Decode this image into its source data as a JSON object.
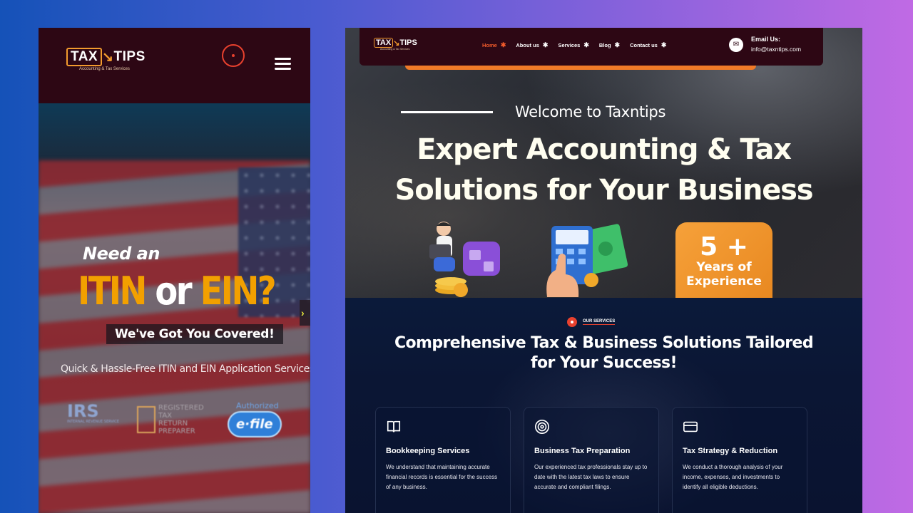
{
  "mobile": {
    "logo": {
      "tax": "TAX",
      "tips": "TIPS",
      "tagline": "Accounting & Tax Services"
    },
    "hero": {
      "need_an": "Need an",
      "itin": "ITIN",
      "or": "or",
      "ein": "EIN?",
      "covered": "We've Got You Covered!",
      "quick": "Quick & Hassle-Free ITIN and EIN Application Services",
      "irs": "IRS",
      "irs_sub": "INTERNAL REVENUE SERVICE",
      "registered": "REGISTERED TAX RETURN PREPARER",
      "authorized": "Authorized",
      "efile": "e·file"
    }
  },
  "desktop": {
    "logo": {
      "tax": "TAX",
      "tips": "TIPS",
      "tagline": "Accounting & Tax Services"
    },
    "nav": [
      {
        "label": "Home",
        "active": true
      },
      {
        "label": "About us",
        "active": false
      },
      {
        "label": "Services",
        "active": false
      },
      {
        "label": "Blog",
        "active": false
      },
      {
        "label": "Contact us",
        "active": false
      }
    ],
    "email_label": "Email Us:",
    "email_value": "info@taxntips.com",
    "hero": {
      "welcome": "Welcome to Taxntips",
      "headline_1": "Expert Accounting & Tax",
      "headline_2": "Solutions for Your Business",
      "exp_num": "5 +",
      "exp_1": "Years of",
      "exp_2": "Experience"
    },
    "services": {
      "tag": "OUR SERVICES",
      "title_1": "Comprehensive Tax & Business Solutions Tailored",
      "title_2": "for Your Success!",
      "cards": [
        {
          "icon": "book-icon",
          "title": "Bookkeeping Services",
          "desc": "We understand that maintaining accurate financial records is essential for the success of any business."
        },
        {
          "icon": "target-icon",
          "title": "Business Tax Preparation",
          "desc": "Our experienced tax professionals stay up to date with the latest tax laws to ensure accurate and compliant filings."
        },
        {
          "icon": "card-icon",
          "title": "Tax Strategy & Reduction",
          "desc": "We conduct a thorough analysis of your income, expenses, and investments to identify all eligible deductions."
        }
      ]
    }
  },
  "colors": {
    "maroon": "#2d0714",
    "orange": "#f07a28",
    "accent_red": "#e8412e",
    "navy": "#0b1a3a"
  }
}
